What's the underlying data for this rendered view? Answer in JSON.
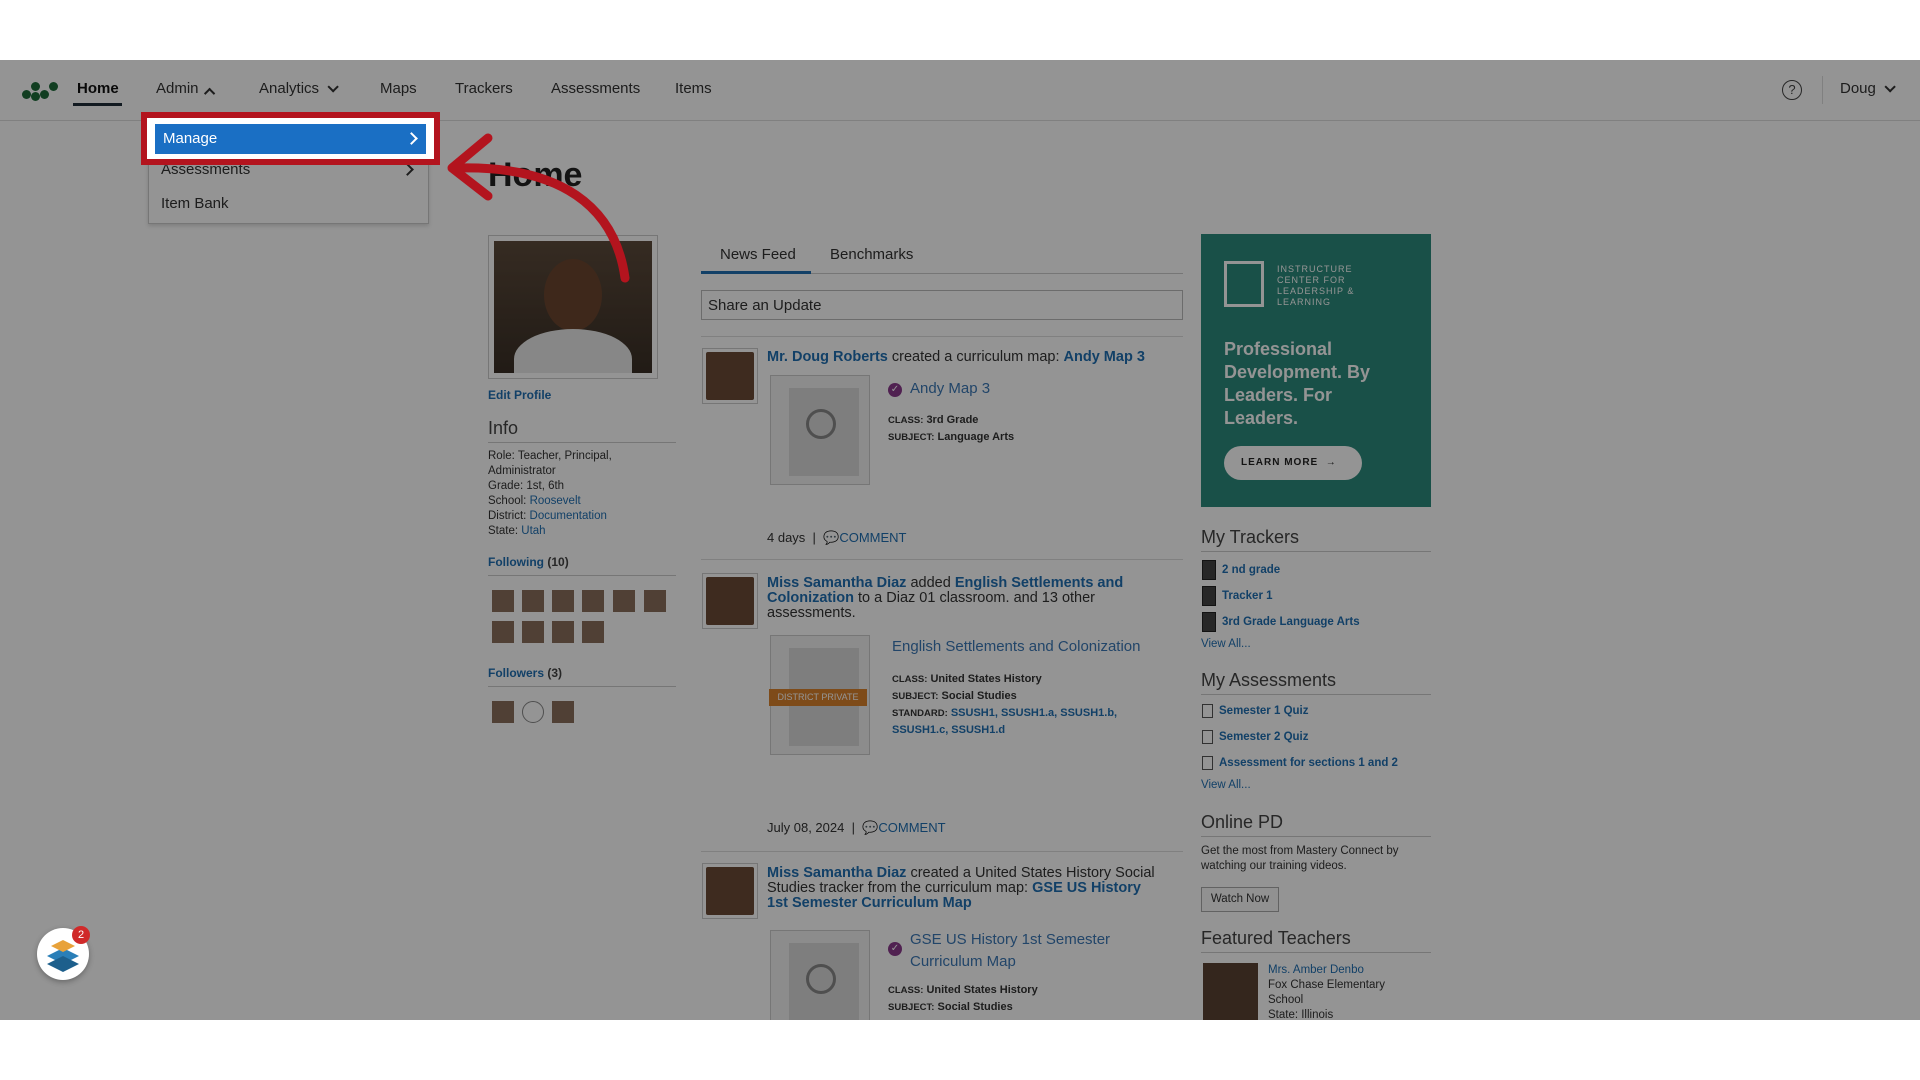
{
  "nav": {
    "items": [
      "Home",
      "Admin",
      "Analytics",
      "Maps",
      "Trackers",
      "Assessments",
      "Items"
    ],
    "user": "Doug",
    "help_glyph": "?"
  },
  "dropdown": {
    "items": [
      "Manage",
      "Assessments",
      "Item Bank"
    ]
  },
  "page": {
    "title": "Home"
  },
  "profile": {
    "edit_link": "Edit Profile",
    "info_heading": "Info",
    "role": "Role: Teacher, Principal, Administrator",
    "grade": "Grade: 1st, 6th",
    "school_label": "School:",
    "school": "Roosevelt",
    "district_label": "District:",
    "district": "Documentation",
    "state_label": "State:",
    "state": "Utah",
    "following_label": "Following",
    "following_count": "(10)",
    "followers_label": "Followers",
    "followers_count": "(3)"
  },
  "feed": {
    "tabs": [
      "News Feed",
      "Benchmarks"
    ],
    "share_placeholder": "Share an Update",
    "posts": [
      {
        "author": "Mr. Doug Roberts",
        "action": "created a curriculum map:",
        "target": "Andy Map 3",
        "card_title": "Andy Map 3",
        "class_label": "CLASS:",
        "class": "3rd Grade",
        "subject_label": "SUBJECT:",
        "subject": "Language Arts",
        "time": "4 days",
        "comment": "COMMENT"
      },
      {
        "author": "Miss Samantha Diaz",
        "action": "added",
        "target": "English Settlements and Colonization",
        "rest": "to a Diaz 01 classroom. and 13 other assessments.",
        "card_title": "English Settlements and Colonization",
        "badge": "DISTRICT PRIVATE",
        "class_label": "CLASS:",
        "class": "United States History",
        "subject_label": "SUBJECT:",
        "subject": "Social Studies",
        "standard_label": "STANDARD:",
        "standard": "SSUSH1, SSUSH1.a, SSUSH1.b, SSUSH1.c, SSUSH1.d",
        "time": "July 08, 2024",
        "comment": "COMMENT"
      },
      {
        "author": "Miss Samantha Diaz",
        "action": "created a United States History Social Studies tracker from the curriculum map:",
        "target": "GSE US History 1st Semester Curriculum Map",
        "card_title": "GSE US History 1st Semester Curriculum Map",
        "class_label": "CLASS:",
        "class": "United States History",
        "subject_label": "SUBJECT:",
        "subject": "Social Studies"
      }
    ]
  },
  "ad": {
    "small": "INSTRUCTURE CENTER FOR LEADERSHIP & LEARNING",
    "headline": "Professional Development. By Leaders. For Leaders.",
    "button": "LEARN MORE"
  },
  "trackers": {
    "heading": "My Trackers",
    "items": [
      "2 nd grade",
      "Tracker 1",
      "3rd Grade Language Arts"
    ],
    "view_all": "View All..."
  },
  "assessments": {
    "heading": "My Assessments",
    "items": [
      "Semester 1 Quiz",
      "Semester 2 Quiz",
      "Assessment for sections 1 and 2"
    ],
    "view_all": "View All..."
  },
  "online_pd": {
    "heading": "Online PD",
    "text": "Get the most from Mastery Connect by watching our training videos.",
    "button": "Watch Now"
  },
  "featured": {
    "heading": "Featured Teachers",
    "name": "Mrs. Amber Denbo",
    "school": "Fox Chase Elementary School",
    "state": "State: Illinois"
  },
  "helper": {
    "badge": "2"
  },
  "colors": {
    "highlight": "#b3141e",
    "manage_bg": "#1a6fc4",
    "link": "#1f6fb2",
    "ad_bg": "#2c8a7c"
  }
}
